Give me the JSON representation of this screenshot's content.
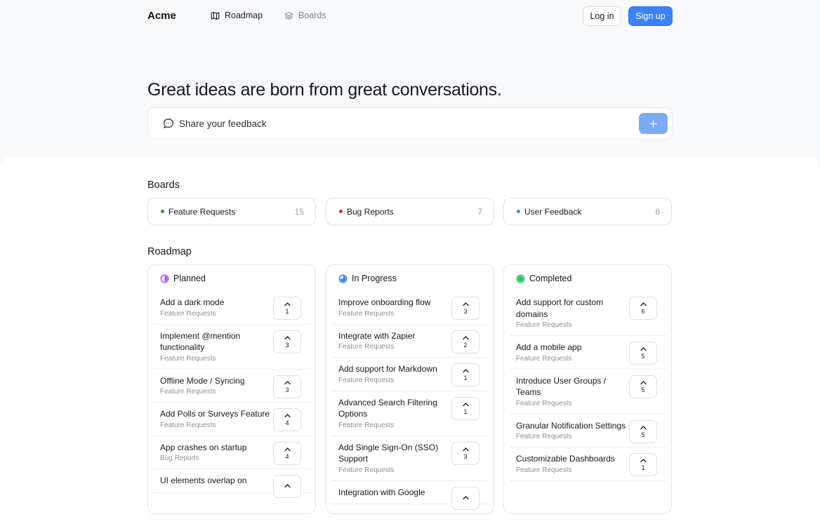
{
  "header": {
    "logo": "Acme",
    "nav": [
      {
        "label": "Roadmap",
        "icon": "map-icon",
        "active": true
      },
      {
        "label": "Boards",
        "icon": "layers-icon",
        "active": false
      }
    ],
    "login_label": "Log in",
    "signup_label": "Sign up"
  },
  "hero": {
    "title": "Great ideas are born from great conversations.",
    "feedback_placeholder": "Share your feedback",
    "add_icon": "plus-icon"
  },
  "boards": {
    "title": "Boards",
    "items": [
      {
        "name": "Feature Requests",
        "count": "15",
        "color": "#16a34a"
      },
      {
        "name": "Bug Reports",
        "count": "7",
        "color": "#dc2626"
      },
      {
        "name": "User Feedback",
        "count": "8",
        "color": "#3b82f6"
      }
    ]
  },
  "roadmap": {
    "title": "Roadmap",
    "columns": [
      {
        "name": "Planned",
        "color": "#a855f7",
        "items": [
          {
            "title": "Add a dark mode",
            "board": "Feature Requests",
            "votes": "1"
          },
          {
            "title": "Implement @mention functionality",
            "board": "Feature Requests",
            "votes": "3"
          },
          {
            "title": "Offline Mode / Syncing",
            "board": "Feature Requests",
            "votes": "3"
          },
          {
            "title": "Add Polls or Surveys Feature",
            "board": "Feature Requests",
            "votes": "4"
          },
          {
            "title": "App crashes on startup",
            "board": "Bug Reports",
            "votes": "4"
          },
          {
            "title": "UI elements overlap on",
            "board": "",
            "votes": ""
          }
        ]
      },
      {
        "name": "In Progress",
        "color": "#3b82f6",
        "items": [
          {
            "title": "Improve onboarding flow",
            "board": "Feature Requests",
            "votes": "3"
          },
          {
            "title": "Integrate with Zapier",
            "board": "Feature Requests",
            "votes": "2"
          },
          {
            "title": "Add support for Markdown",
            "board": "Feature Requests",
            "votes": "1"
          },
          {
            "title": "Advanced Search Filtering Options",
            "board": "Feature Requests",
            "votes": "1"
          },
          {
            "title": "Add Single Sign-On (SSO) Support",
            "board": "Feature Requests",
            "votes": "3"
          },
          {
            "title": "Integration with Google",
            "board": "",
            "votes": ""
          }
        ]
      },
      {
        "name": "Completed",
        "color": "#22c55e",
        "items": [
          {
            "title": "Add support for custom domains",
            "board": "Feature Requests",
            "votes": "6"
          },
          {
            "title": "Add a mobile app",
            "board": "Feature Requests",
            "votes": "5"
          },
          {
            "title": "Introduce User Groups / Teams",
            "board": "Feature Requests",
            "votes": "5"
          },
          {
            "title": "Granular Notification Settings",
            "board": "Feature Requests",
            "votes": "5"
          },
          {
            "title": "Customizable Dashboards",
            "board": "Feature Requests",
            "votes": "1"
          }
        ]
      }
    ]
  }
}
